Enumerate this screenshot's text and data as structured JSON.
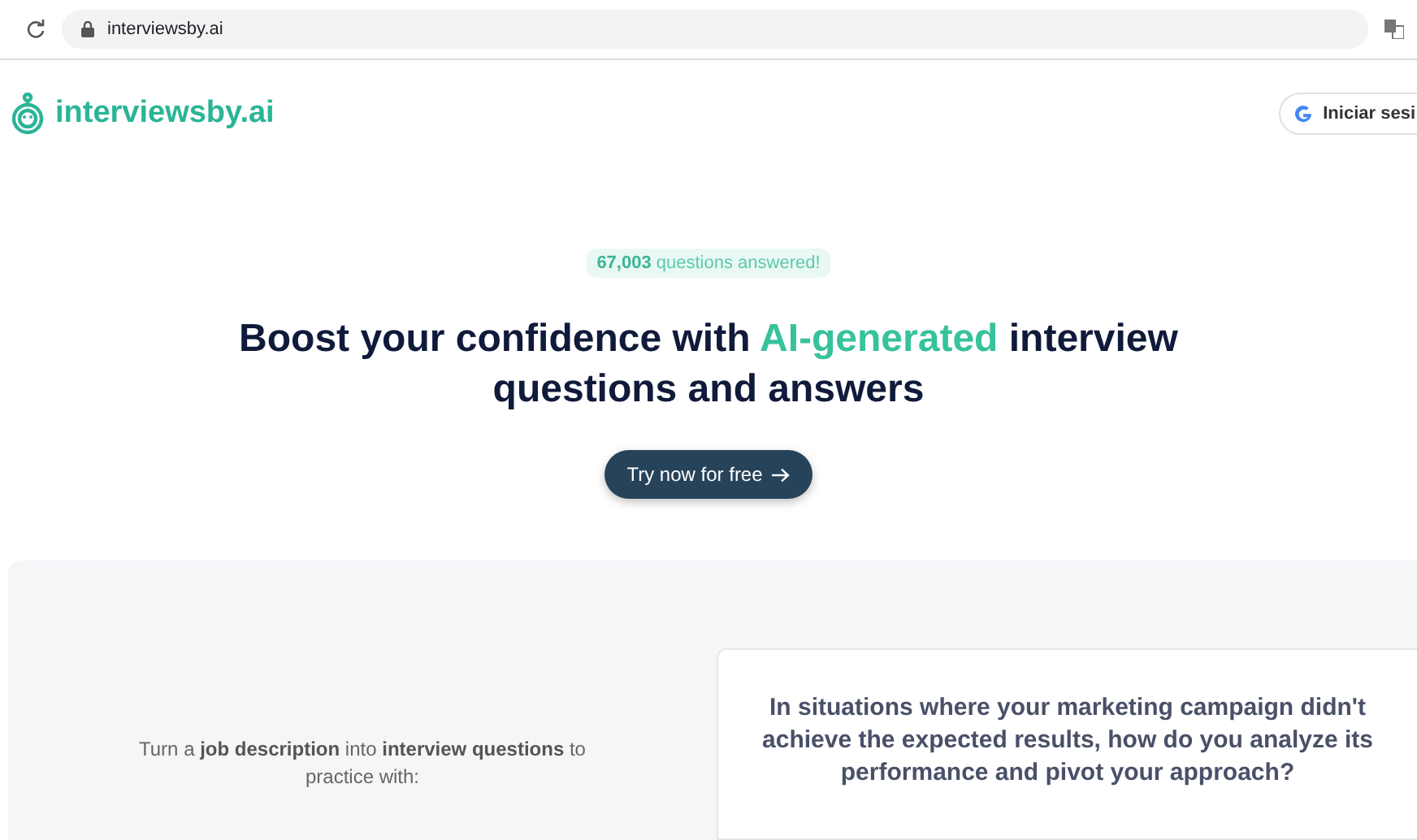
{
  "browser": {
    "url": "interviewsby.ai"
  },
  "header": {
    "logo": "interviewsby.ai",
    "sign_in": "Iniciar sesi"
  },
  "hero": {
    "badge": "**67,003** questions answered!",
    "heading": [
      {
        "text": "Boost your confidence with ",
        "highlight": false
      },
      {
        "text": "AI-generated",
        "highlight": true
      },
      {
        "text": " interview questions and answers",
        "highlight": false
      }
    ],
    "cta": "Try now for free"
  },
  "demo": {
    "intro": "Turn a **job description** into **interview questions** to practice with:",
    "question": "In situations where your marketing campaign didn't achieve the expected results, how do you analyze its performance and pivot your approach?"
  }
}
